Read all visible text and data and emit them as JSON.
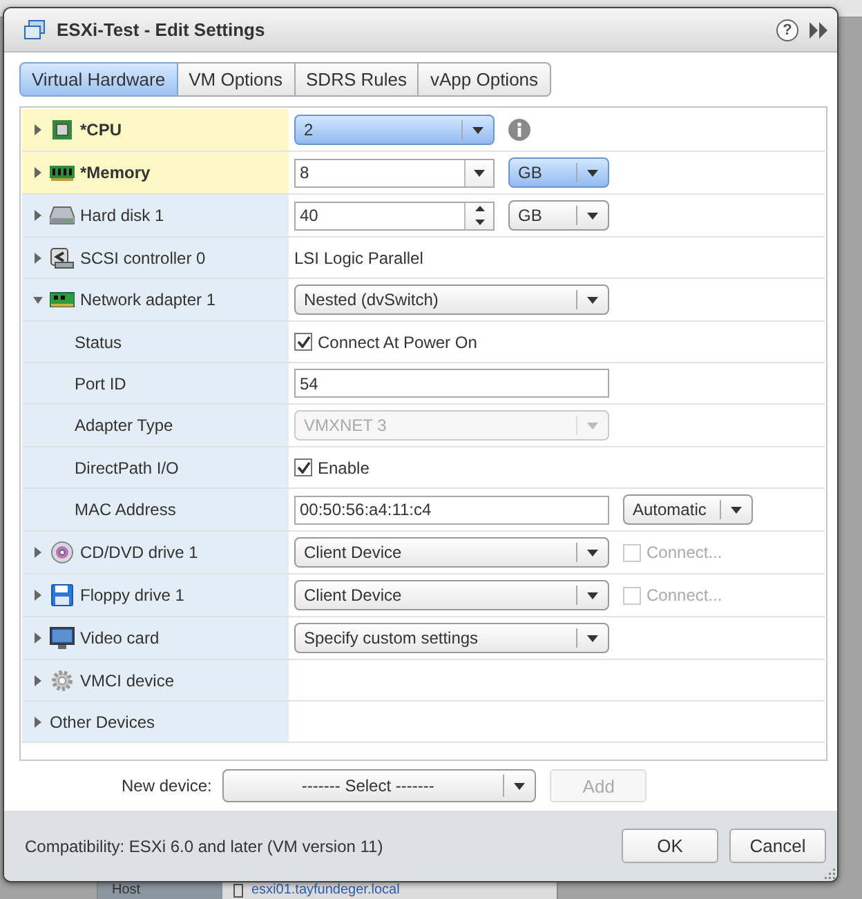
{
  "background": {
    "host_label": "Host",
    "host_value": "esxi01.tayfundeger.local"
  },
  "dialog": {
    "title": "ESXi-Test - Edit Settings",
    "help": "?"
  },
  "tabs": [
    {
      "label": "Virtual Hardware",
      "selected": true
    },
    {
      "label": "VM Options",
      "selected": false
    },
    {
      "label": "SDRS Rules",
      "selected": false
    },
    {
      "label": "vApp Options",
      "selected": false
    }
  ],
  "devices": [
    {
      "kind": "cpu",
      "label": "*CPU",
      "expanded": false,
      "modified": true,
      "cells": [
        {
          "kind": "select",
          "value": "2",
          "highlighted": true,
          "disabled": false
        },
        {
          "kind": "info"
        }
      ]
    },
    {
      "kind": "memory",
      "label": "*Memory",
      "expanded": false,
      "modified": true,
      "cells": [
        {
          "kind": "combo",
          "value": "8"
        },
        {
          "kind": "select",
          "value": "GB",
          "highlighted": true,
          "disabled": false
        }
      ]
    },
    {
      "kind": "disk",
      "label": "Hard disk 1",
      "expanded": false,
      "modified": false,
      "cells": [
        {
          "kind": "spin",
          "value": "40"
        },
        {
          "kind": "select",
          "value": "GB",
          "highlighted": false,
          "disabled": false
        }
      ]
    },
    {
      "kind": "controller",
      "label": "SCSI controller 0",
      "expanded": false,
      "modified": false,
      "cells": [
        {
          "kind": "text",
          "value": "LSI Logic Parallel"
        }
      ]
    },
    {
      "kind": "network",
      "label": "Network adapter 1",
      "expanded": true,
      "modified": false,
      "cells": [
        {
          "kind": "select",
          "value": "Nested (dvSwitch)",
          "highlighted": false,
          "disabled": false
        }
      ],
      "children": [
        {
          "label": "Status",
          "cells": [
            {
              "kind": "checkbox",
              "label": "Connect At Power On",
              "checked": true,
              "disabled": false
            }
          ]
        },
        {
          "label": "Port ID",
          "cells": [
            {
              "kind": "input",
              "value": "54"
            }
          ]
        },
        {
          "label": "Adapter Type",
          "cells": [
            {
              "kind": "select",
              "value": "VMXNET 3",
              "highlighted": false,
              "disabled": true
            }
          ]
        },
        {
          "label": "DirectPath I/O",
          "cells": [
            {
              "kind": "checkbox",
              "label": "Enable",
              "checked": true,
              "disabled": false
            }
          ]
        },
        {
          "label": "MAC Address",
          "cells": [
            {
              "kind": "input",
              "value": "00:50:56:a4:11:c4"
            },
            {
              "kind": "select",
              "value": "Automatic",
              "highlighted": false,
              "disabled": false
            }
          ]
        }
      ]
    },
    {
      "kind": "cdrom",
      "label": "CD/DVD drive 1",
      "expanded": false,
      "modified": false,
      "cells": [
        {
          "kind": "select",
          "value": "Client Device",
          "highlighted": false,
          "disabled": false
        },
        {
          "kind": "checkbox",
          "label": "Connect...",
          "checked": false,
          "disabled": true
        }
      ]
    },
    {
      "kind": "floppy",
      "label": "Floppy drive 1",
      "expanded": false,
      "modified": false,
      "cells": [
        {
          "kind": "select",
          "value": "Client Device",
          "highlighted": false,
          "disabled": false
        },
        {
          "kind": "checkbox",
          "label": "Connect...",
          "checked": false,
          "disabled": true
        }
      ]
    },
    {
      "kind": "video",
      "label": "Video card",
      "expanded": false,
      "modified": false,
      "cells": [
        {
          "kind": "select",
          "value": "Specify custom settings",
          "highlighted": false,
          "disabled": false
        }
      ]
    },
    {
      "kind": "vmci",
      "label": "VMCI device",
      "expanded": false,
      "modified": false
    },
    {
      "kind": "other",
      "label": "Other Devices",
      "expanded": false,
      "modified": false
    }
  ],
  "new_device": {
    "label": "New device:",
    "select": "------- Select -------",
    "add": {
      "label": "Add",
      "disabled": true
    }
  },
  "footer": {
    "compatibility": "Compatibility: ESXi 6.0 and later (VM version 11)",
    "buttons": [
      "OK",
      "Cancel"
    ]
  }
}
